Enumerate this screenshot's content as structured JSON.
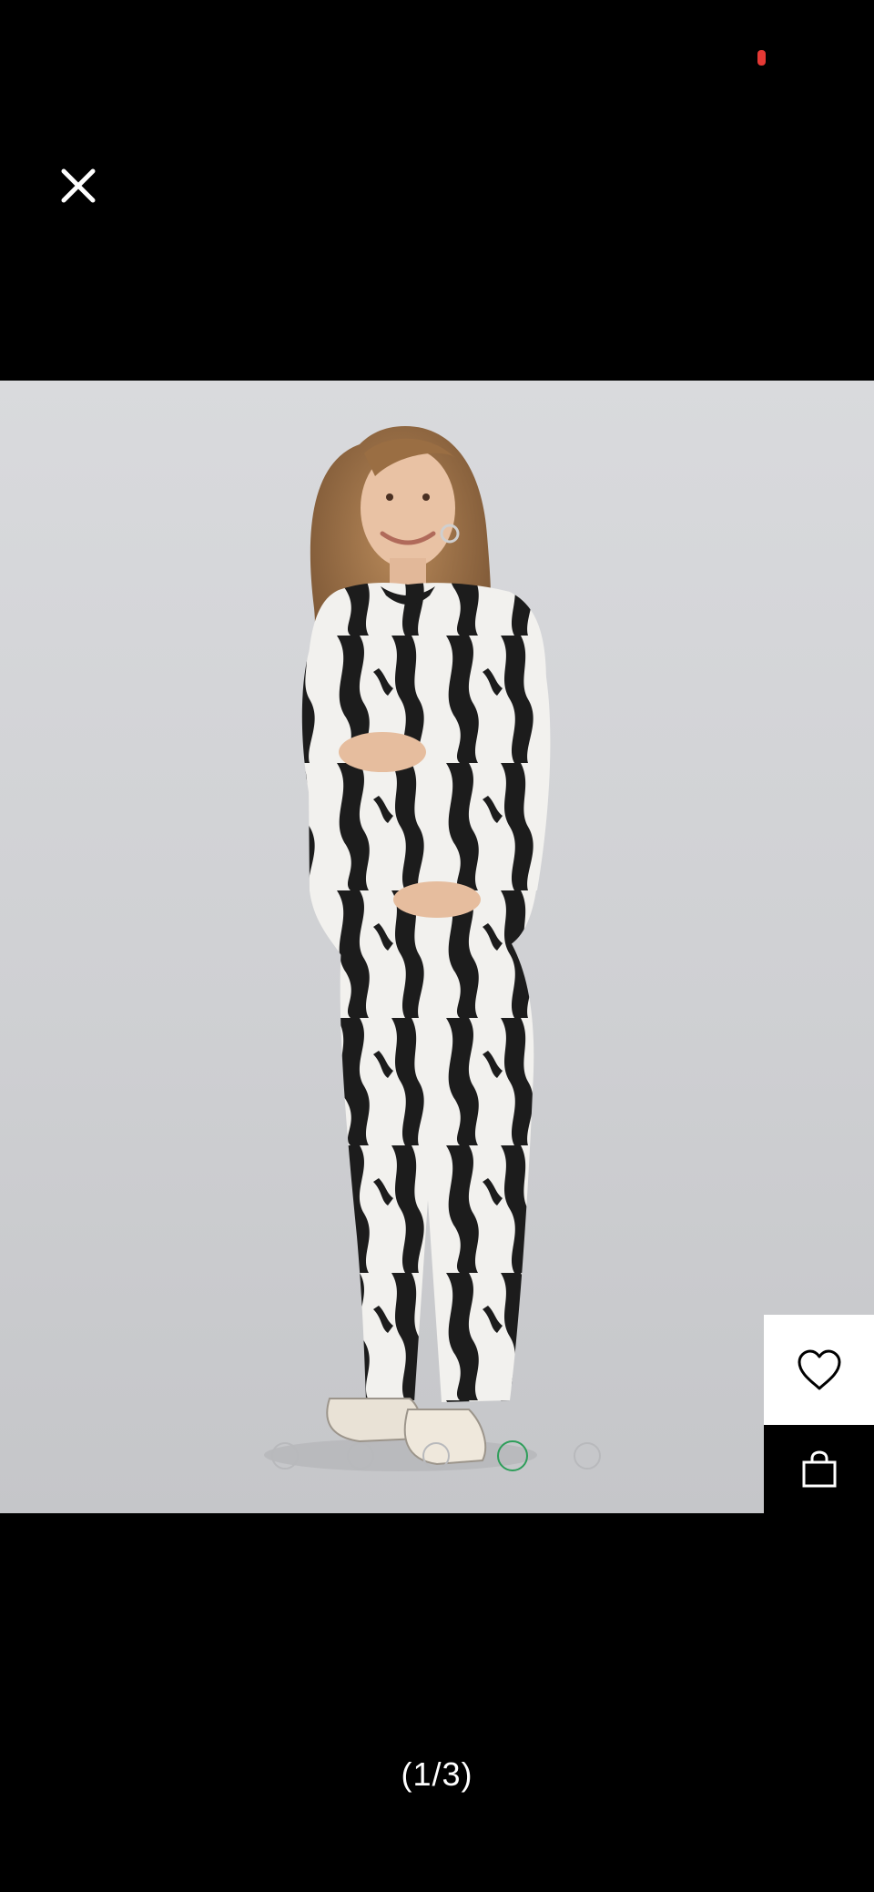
{
  "viewer": {
    "counter_text": "(1/3)",
    "active_dot_index": 3,
    "dot_count": 5
  },
  "icons": {
    "close": "close-icon",
    "wishlist": "heart-icon",
    "bag": "shopping-bag-icon"
  },
  "colors": {
    "background": "#000000",
    "active_dot": "#2e9e5a",
    "status_indicator": "#e53935"
  }
}
